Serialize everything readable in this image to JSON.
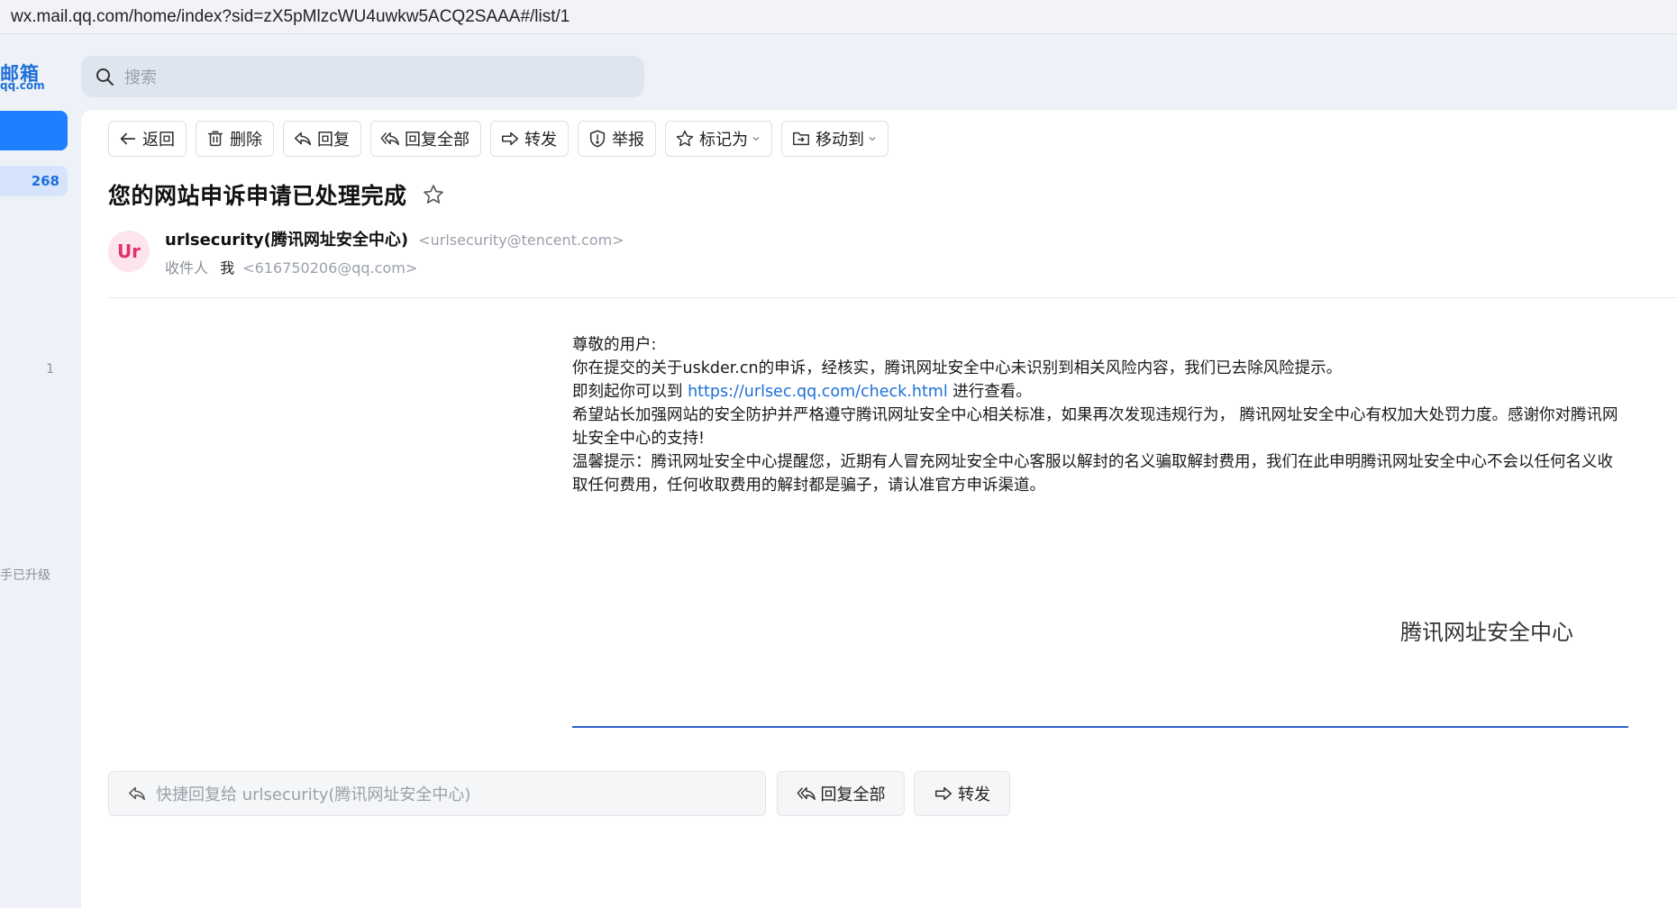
{
  "browser": {
    "url": "wx.mail.qq.com/home/index?sid=zX5pMlzcWU4uwkw5ACQ2SAAA#/list/1"
  },
  "sidebar": {
    "logo_main": "邮箱",
    "logo_sub": "qq.com",
    "inbox_count": "268",
    "secondary_count": "1",
    "upgrade_text": "手已升级"
  },
  "search": {
    "placeholder": "搜索"
  },
  "toolbar": {
    "back": "返回",
    "delete": "删除",
    "reply": "回复",
    "reply_all": "回复全部",
    "forward": "转发",
    "report": "举报",
    "mark_as": "标记为",
    "move_to": "移动到"
  },
  "email": {
    "subject": "您的网站申诉申请已处理完成",
    "avatar_text": "Ur",
    "sender_name": "urlsecurity(腾讯网址安全中心)",
    "sender_email": "<urlsecurity@tencent.com>",
    "recipient_label": "收件人",
    "recipient_name": "我",
    "recipient_email": "<616750206@qq.com>",
    "body": {
      "greeting": "尊敬的用户:",
      "line1": "你在提交的关于uskder.cn的申诉，经核实，腾讯网址安全中心未识别到相关风险内容，我们已去除风险提示。",
      "line2_prefix": "即刻起你可以到 ",
      "line2_link": "https://urlsec.qq.com/check.html",
      "line2_suffix": " 进行查看。",
      "line3": "希望站长加强网站的安全防护并严格遵守腾讯网址安全中心相关标准，如果再次发现违规行为， 腾讯网址安全中心有权加大处罚力度。感谢你对腾讯网址安全中心的支持!",
      "line4": "温馨提示：腾讯网址安全中心提醒您，近期有人冒充网址安全中心客服以解封的名义骗取解封费用，我们在此申明腾讯网址安全中心不会以任何名义收取任何费用，任何收取费用的解封都是骗子，请认准官方申诉渠道。",
      "signature": "腾讯网址安全中心"
    }
  },
  "quick_reply": {
    "placeholder": "快捷回复给 urlsecurity(腾讯网址安全中心)",
    "reply_all": "回复全部",
    "forward": "转发"
  },
  "colors": {
    "accent": "#1e80ff",
    "link": "#1e6fd9",
    "avatar_bg": "#fde4ee",
    "avatar_fg": "#e0336b"
  }
}
